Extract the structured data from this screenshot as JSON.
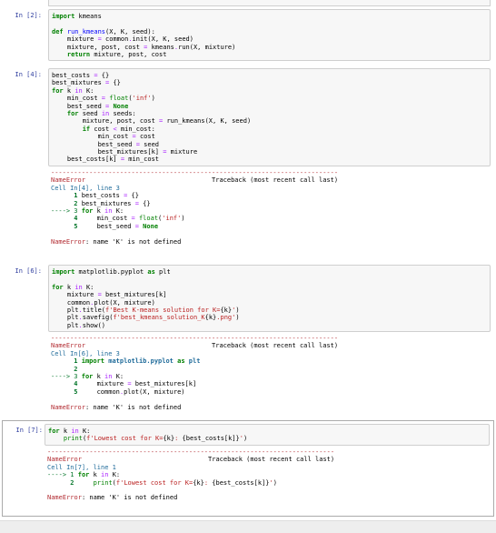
{
  "cells": [
    {
      "prompt": "In [2]:",
      "code": "import kmeans\n\ndef run_kmeans(X, K, seed):\n    mixture = common.init(X, K, seed)\n    mixture, post, cost = kmeans.run(X, mixture)\n    return mixture, post, cost"
    },
    {
      "prompt": "In [4]:",
      "code": "best_costs = {}\nbest_mixtures = {}\nfor k in K:\n    min_cost = float('inf')\n    best_seed = None\n    for seed in seeds:\n        mixture, post, cost = run_kmeans(X, K, seed)\n        if cost < min_cost:\n            min_cost = cost\n            best_seed = seed\n            best_mixtures[k] = mixture\n    best_costs[k] = min_cost",
      "error": {
        "dashes": "---------------------------------------------------------------------------",
        "name": "NameError",
        "traceback_title": "Traceback (most recent call last)",
        "cell_ref": "Cell In[4], line 3",
        "lines": [
          "      1 best_costs = {}",
          "      2 best_mixtures = {}",
          "----> 3 for k in K:",
          "      4     min_cost = float('inf')",
          "      5     best_seed = None"
        ],
        "message": "NameError: name 'K' is not defined"
      }
    },
    {
      "prompt": "In [6]:",
      "code": "import matplotlib.pyplot as plt\n\nfor k in K:\n    mixture = best_mixtures[k]\n    common.plot(X, mixture)\n    plt.title(f'Best K-means solution for K={k}')\n    plt.savefig(f'best_kmeans_solution_K{k}.png')\n    plt.show()",
      "error": {
        "dashes": "---------------------------------------------------------------------------",
        "name": "NameError",
        "traceback_title": "Traceback (most recent call last)",
        "cell_ref": "Cell In[6], line 3",
        "lines": [
          "      1 import matplotlib.pyplot as plt",
          "      2",
          "----> 3 for k in K:",
          "      4     mixture = best_mixtures[k]",
          "      5     common.plot(X, mixture)"
        ],
        "message": "NameError: name 'K' is not defined"
      }
    },
    {
      "prompt": "In [7]:",
      "code": "for k in K:\n    print(f'Lowest cost for K={k}: {best_costs[k]}')",
      "error": {
        "dashes": "---------------------------------------------------------------------------",
        "name": "NameError",
        "traceback_title": "Traceback (most recent call last)",
        "cell_ref": "Cell In[7], line 1",
        "lines": [
          "----> 1 for k in K:",
          "      2     print(f'Lowest cost for K={k}: {best_costs[k]}')"
        ],
        "message": "NameError: name 'K' is not defined"
      }
    }
  ]
}
